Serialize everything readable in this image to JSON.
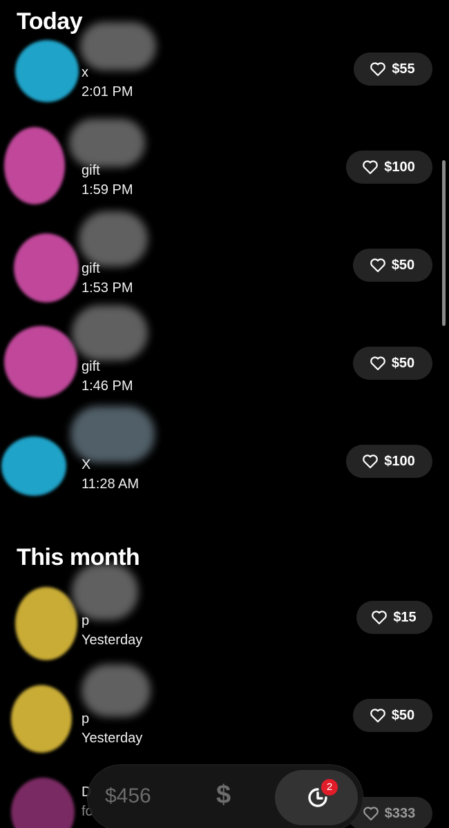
{
  "sections": {
    "today": "Today",
    "this_month": "This month"
  },
  "today_rows": [
    {
      "note": "x",
      "time": "2:01 PM",
      "amount": "$55",
      "avatar_color": "#1fa3c8"
    },
    {
      "note": "gift",
      "time": "1:59 PM",
      "amount": "$100",
      "avatar_color": "#c0479a"
    },
    {
      "note": "gift",
      "time": "1:53 PM",
      "amount": "$50",
      "avatar_color": "#c0479a"
    },
    {
      "note": "gift",
      "time": "1:46 PM",
      "amount": "$50",
      "avatar_color": "#c0479a"
    },
    {
      "note": "X",
      "time": "11:28 AM",
      "amount": "$100",
      "avatar_color": "#1fa3c8"
    }
  ],
  "month_rows": [
    {
      "note": "p",
      "time": "Yesterday",
      "amount": "$15",
      "avatar_color": "#c9ac35"
    },
    {
      "note": "p",
      "time": "Yesterday",
      "amount": "$50",
      "avatar_color": "#c9ac35"
    },
    {
      "note": "D",
      "time": "fo",
      "amount": "$333",
      "avatar_color": "#7a2a62"
    }
  ],
  "nav": {
    "balance": "$456",
    "money_icon": "$",
    "activity_badge": "2",
    "activity_icon": "clock-icon"
  }
}
